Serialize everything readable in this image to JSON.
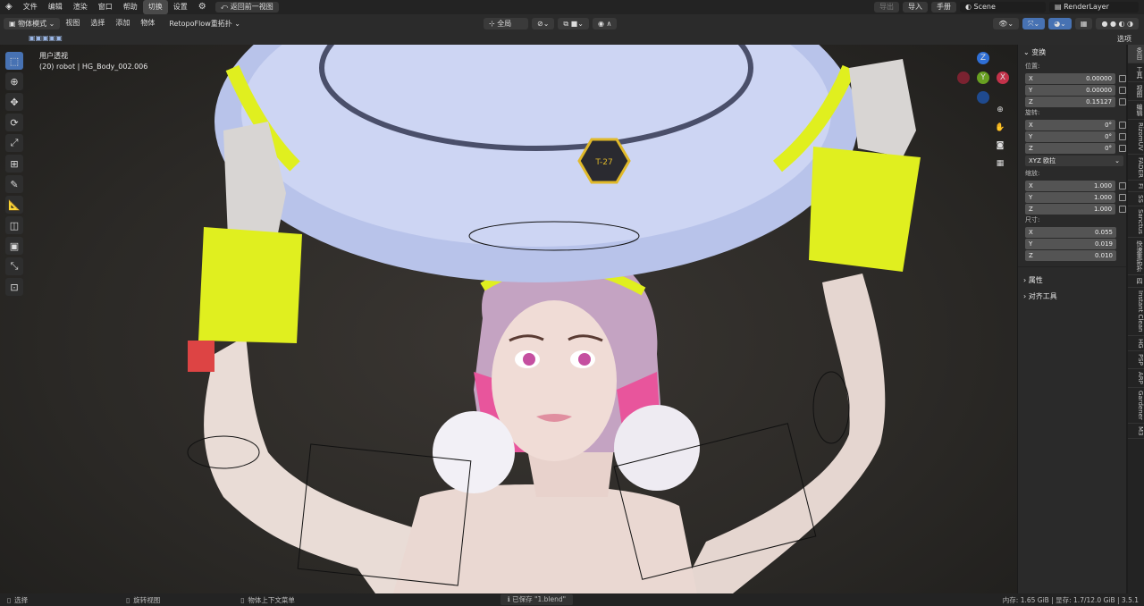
{
  "topbar": {
    "menus": [
      "文件",
      "编辑",
      "渲染",
      "窗口",
      "帮助"
    ],
    "workspace_tab": "切换",
    "settings_label": "设置",
    "back_btn": "返回前一视图",
    "export": "导出",
    "import": "导入",
    "manual": "手册",
    "scene": "Scene",
    "render_layer": "RenderLayer"
  },
  "header": {
    "mode": "物体模式",
    "menus": [
      "视图",
      "选择",
      "添加",
      "物体"
    ],
    "retopo": "RetopoFlow重拓扑",
    "transform_orient": "全局",
    "options": "选项"
  },
  "viewport": {
    "view_name": "用户透视",
    "object_info": "(20) robot | HG_Body_002.006",
    "logo_text": "T-27"
  },
  "npanel": {
    "transform_title": "变换",
    "location_label": "位置:",
    "location": {
      "x": "0.00000",
      "y": "0.00000",
      "z": "0.15127"
    },
    "rotation_label": "旋转:",
    "rotation": {
      "x": "0°",
      "y": "0°",
      "z": "0°"
    },
    "rotation_mode": "XYZ 欧拉",
    "scale_label": "缩放:",
    "scale": {
      "x": "1.000",
      "y": "1.000",
      "z": "1.000"
    },
    "dimensions_label": "尺寸:",
    "dimensions": {
      "x": "0.055",
      "y": "0.019",
      "z": "0.010"
    },
    "properties": "属性",
    "align_tools": "对齐工具",
    "axis_labels": {
      "x": "X",
      "y": "Y",
      "z": "Z"
    }
  },
  "vtabs": [
    "条目",
    "工具",
    "视图",
    "编辑",
    "RizomUV",
    "FADER",
    "FI",
    "SS",
    "Sanctus",
    "快速重拓扑",
    "四",
    "Instant Clean",
    "HG",
    "PSP",
    "ARP",
    "Gardener",
    "M3"
  ],
  "statusbar": {
    "select": "选择",
    "rotate": "旋转视图",
    "context": "物体上下文菜单",
    "saved": "已保存 \"1.blend\"",
    "memory": "内存: 1.65 GiB | 显存: 1.7/12.0 GiB | 3.5.1"
  },
  "colors": {
    "accent": "#4772b3",
    "yellow": "#e0ef1f",
    "pink": "#e8559c"
  }
}
